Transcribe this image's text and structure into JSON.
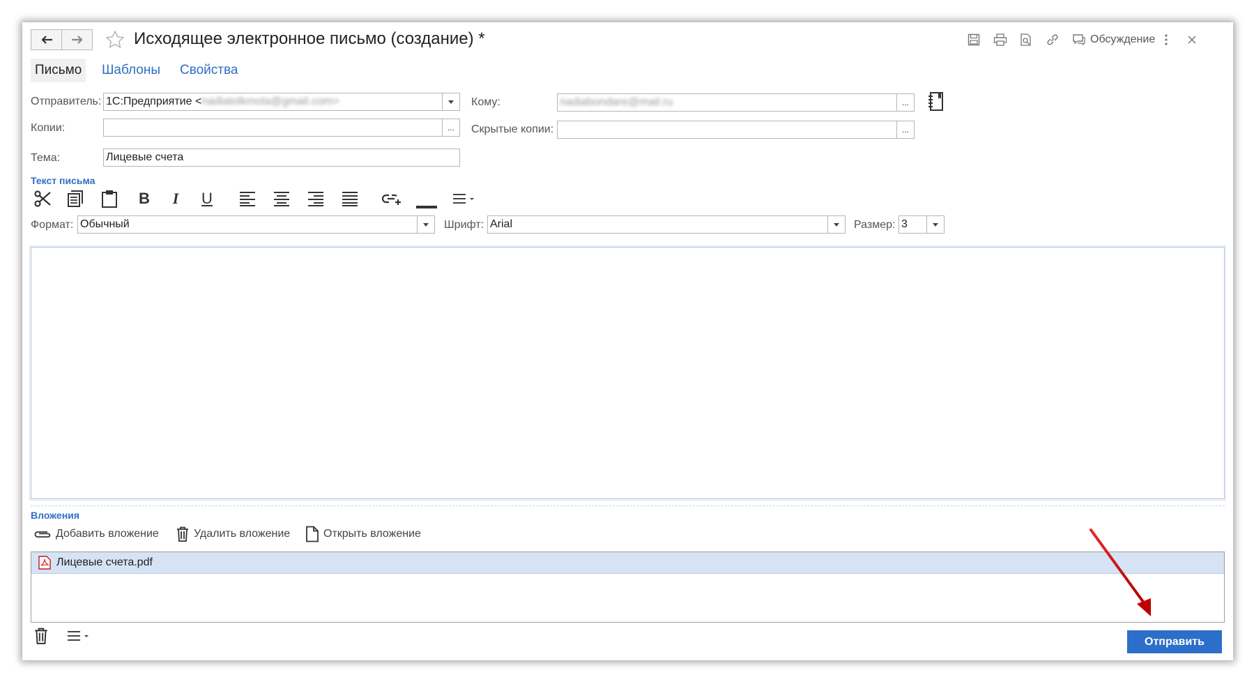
{
  "window": {
    "title": "Исходящее электронное письмо (создание) *",
    "discussion_label": "Обсуждение"
  },
  "tabs": [
    {
      "label": "Письмо",
      "active": true
    },
    {
      "label": "Шаблоны",
      "active": false
    },
    {
      "label": "Свойства",
      "active": false
    }
  ],
  "form": {
    "sender_label": "Отправитель:",
    "sender_value_prefix": "1С:Предприятие <",
    "sender_value_email": "nadiatolkmola@gmail.com>",
    "copies_label": "Копии:",
    "copies_value": "",
    "subject_label": "Тема:",
    "subject_value": "Лицевые счета",
    "to_label": "Кому:",
    "to_value": "nadiabondare@mail.ru",
    "bcc_label": "Скрытые копии:",
    "bcc_value": "",
    "ellipsis": "..."
  },
  "editor": {
    "section_title": "Текст письма",
    "format_label": "Формат:",
    "format_value": "Обычный",
    "font_label": "Шрифт:",
    "font_value": "Arial",
    "size_label": "Размер:",
    "size_value": "3",
    "tools": [
      "cut-icon",
      "copy-icon",
      "paste-icon",
      "bold-icon",
      "italic-icon",
      "underline-icon",
      "align-left-icon",
      "align-center-icon",
      "align-right-icon",
      "align-justify-icon",
      "insert-link-icon",
      "text-color-icon",
      "more-menu-icon"
    ]
  },
  "attachments": {
    "section_title": "Вложения",
    "add_label": "Добавить вложение",
    "delete_label": "Удалить вложение",
    "open_label": "Открыть вложение",
    "files": [
      {
        "name": "Лицевые счета.pdf",
        "selected": true
      }
    ]
  },
  "footer": {
    "send_label": "Отправить"
  },
  "colors": {
    "accent": "#2c6fc8",
    "section_title": "#2f6fc4",
    "selected_row": "#d5e3f5",
    "arrow": "#d0021b"
  }
}
